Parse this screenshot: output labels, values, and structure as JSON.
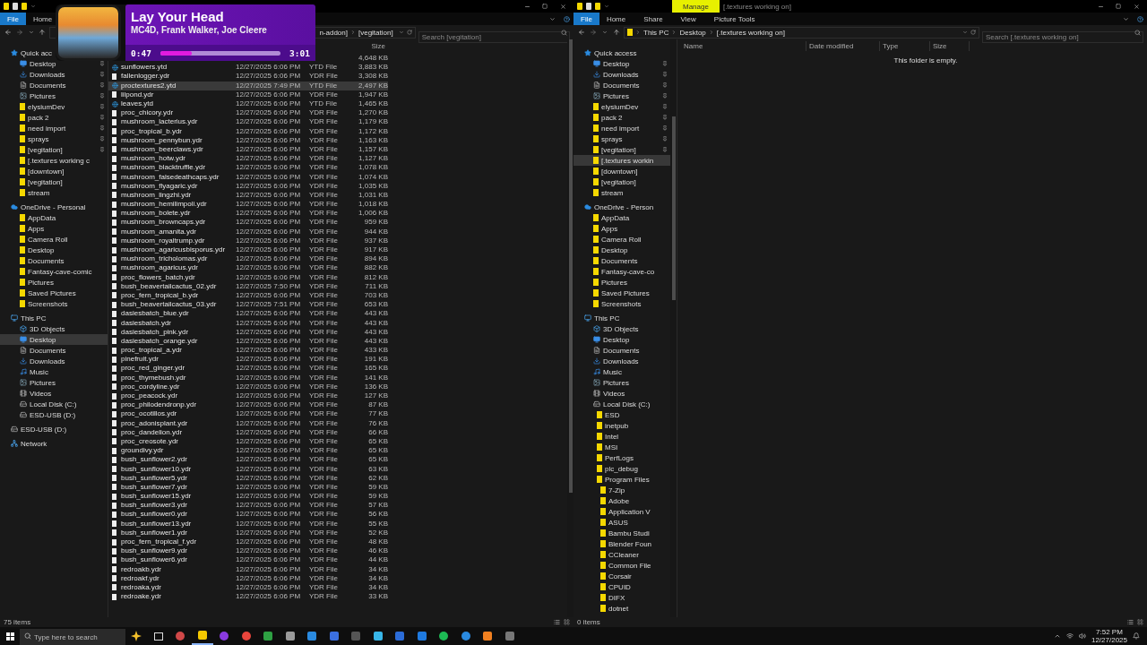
{
  "left_window": {
    "ribbon_tabs": [
      {
        "label": "File",
        "kind": "file"
      },
      {
        "label": "Home",
        "kind": "tab"
      }
    ],
    "address": [
      "n-addon]",
      "[vegitation]"
    ],
    "search": {
      "placeholder": "Search [vegitation]"
    },
    "nav": [
      {
        "label": "Quick acc",
        "kind": "star",
        "selected": false,
        "children": [
          {
            "label": "Desktop",
            "kind": "desktop",
            "pinned": true,
            "selected": false
          },
          {
            "label": "Downloads",
            "kind": "download",
            "pinned": true,
            "selected": false
          },
          {
            "label": "Documents",
            "kind": "document",
            "pinned": true,
            "selected": false
          },
          {
            "label": "Pictures",
            "kind": "picture",
            "pinned": true,
            "selected": false
          },
          {
            "label": "elysiumDev",
            "kind": "folder",
            "pinned": true,
            "selected": false
          },
          {
            "label": "pack 2",
            "kind": "folder",
            "pinned": true,
            "selected": false
          },
          {
            "label": "need import",
            "kind": "folder",
            "pinned": true,
            "selected": false
          },
          {
            "label": "sprays",
            "kind": "folder",
            "pinned": true,
            "selected": false
          },
          {
            "label": "[vegitation]",
            "kind": "folder",
            "pinned": true,
            "selected": false
          },
          {
            "label": "[.textures working c",
            "kind": "folder",
            "pinned": false,
            "selected": false
          },
          {
            "label": "[downtown]",
            "kind": "folder",
            "pinned": false,
            "selected": false
          },
          {
            "label": "[vegitation]",
            "kind": "folder",
            "pinned": false,
            "selected": false
          },
          {
            "label": "stream",
            "kind": "folder",
            "pinned": false,
            "selected": false
          }
        ]
      },
      {
        "label": "OneDrive - Personal",
        "kind": "cloud",
        "selected": false,
        "children": [
          {
            "label": "AppData",
            "kind": "folder",
            "selected": false
          },
          {
            "label": "Apps",
            "kind": "folder",
            "selected": false
          },
          {
            "label": "Camera Roll",
            "kind": "folder",
            "selected": false
          },
          {
            "label": "Desktop",
            "kind": "folder",
            "selected": false
          },
          {
            "label": "Documents",
            "kind": "folder",
            "selected": false
          },
          {
            "label": "Fantasy-cave-comic",
            "kind": "folder",
            "selected": false
          },
          {
            "label": "Pictures",
            "kind": "folder",
            "selected": false
          },
          {
            "label": "Saved Pictures",
            "kind": "folder",
            "selected": false
          },
          {
            "label": "Screenshots",
            "kind": "folder",
            "selected": false
          }
        ]
      },
      {
        "label": "This PC",
        "kind": "pc",
        "selected": false,
        "children": [
          {
            "label": "3D Objects",
            "kind": "objects",
            "selected": false
          },
          {
            "label": "Desktop",
            "kind": "desktop",
            "selected": true
          },
          {
            "label": "Documents",
            "kind": "document",
            "selected": false
          },
          {
            "label": "Downloads",
            "kind": "download",
            "selected": false
          },
          {
            "label": "Music",
            "kind": "music",
            "selected": false
          },
          {
            "label": "Pictures",
            "kind": "picture",
            "selected": false
          },
          {
            "label": "Videos",
            "kind": "video",
            "selected": false
          },
          {
            "label": "Local Disk (C:)",
            "kind": "disk",
            "selected": false
          },
          {
            "label": "ESD-USB (D:)",
            "kind": "disk",
            "selected": false
          }
        ]
      },
      {
        "label": "ESD-USB (D:)",
        "kind": "disk",
        "selected": false
      },
      {
        "label": "Network",
        "kind": "network",
        "selected": false
      }
    ],
    "header": {
      "size": "Size"
    },
    "files": [
      {
        "size": "4,648 KB",
        "selected": false
      },
      {
        "name": "sunflowers.ytd",
        "date": "12/27/2025 6:06 PM",
        "type": "YTD File",
        "size": "3,883 KB",
        "kind": "texture",
        "selected": false
      },
      {
        "name": "fallenlogger.ydr",
        "date": "12/27/2025 6:06 PM",
        "type": "YDR File",
        "size": "3,308 KB",
        "kind": "model",
        "selected": false
      },
      {
        "name": "proctextures2.ytd",
        "date": "12/27/2025 7:49 PM",
        "type": "YTD File",
        "size": "2,497 KB",
        "kind": "texture",
        "selected": true
      },
      {
        "name": "lilpond.ydr",
        "date": "12/27/2025 6:06 PM",
        "type": "YDR File",
        "size": "1,947 KB",
        "kind": "model",
        "selected": false
      },
      {
        "name": "leaves.ytd",
        "date": "12/27/2025 6:06 PM",
        "type": "YTD File",
        "size": "1,465 KB",
        "kind": "texture",
        "selected": false
      },
      {
        "name": "proc_chicory.ydr",
        "date": "12/27/2025 6:06 PM",
        "type": "YDR File",
        "size": "1,270 KB",
        "kind": "model",
        "selected": false
      },
      {
        "name": "mushroom_lacterius.ydr",
        "date": "12/27/2025 6:06 PM",
        "type": "YDR File",
        "size": "1,179 KB",
        "kind": "model",
        "selected": false
      },
      {
        "name": "proc_tropical_b.ydr",
        "date": "12/27/2025 6:06 PM",
        "type": "YDR File",
        "size": "1,172 KB",
        "kind": "model",
        "selected": false
      },
      {
        "name": "mushroom_pennybun.ydr",
        "date": "12/27/2025 6:06 PM",
        "type": "YDR File",
        "size": "1,163 KB",
        "kind": "model",
        "selected": false
      },
      {
        "name": "mushroom_beerclaws.ydr",
        "date": "12/27/2025 6:06 PM",
        "type": "YDR File",
        "size": "1,157 KB",
        "kind": "model",
        "selected": false
      },
      {
        "name": "mushroom_hotw.ydr",
        "date": "12/27/2025 6:06 PM",
        "type": "YDR File",
        "size": "1,127 KB",
        "kind": "model",
        "selected": false
      },
      {
        "name": "mushroom_blacktruffle.ydr",
        "date": "12/27/2025 6:06 PM",
        "type": "YDR File",
        "size": "1,078 KB",
        "kind": "model",
        "selected": false
      },
      {
        "name": "mushroom_falsedeathcaps.ydr",
        "date": "12/27/2025 6:06 PM",
        "type": "YDR File",
        "size": "1,074 KB",
        "kind": "model",
        "selected": false
      },
      {
        "name": "mushroom_flyagaric.ydr",
        "date": "12/27/2025 6:06 PM",
        "type": "YDR File",
        "size": "1,035 KB",
        "kind": "model",
        "selected": false
      },
      {
        "name": "mushroom_lingzhi.ydr",
        "date": "12/27/2025 6:06 PM",
        "type": "YDR File",
        "size": "1,031 KB",
        "kind": "model",
        "selected": false
      },
      {
        "name": "mushroom_hemilimpoli.ydr",
        "date": "12/27/2025 6:06 PM",
        "type": "YDR File",
        "size": "1,018 KB",
        "kind": "model",
        "selected": false
      },
      {
        "name": "mushroom_bolete.ydr",
        "date": "12/27/2025 6:06 PM",
        "type": "YDR File",
        "size": "1,006 KB",
        "kind": "model",
        "selected": false
      },
      {
        "name": "mushroom_browncaps.ydr",
        "date": "12/27/2025 6:06 PM",
        "type": "YDR File",
        "size": "959 KB",
        "kind": "model",
        "selected": false
      },
      {
        "name": "mushroom_amanita.ydr",
        "date": "12/27/2025 6:06 PM",
        "type": "YDR File",
        "size": "944 KB",
        "kind": "model",
        "selected": false
      },
      {
        "name": "mushroom_royaltrump.ydr",
        "date": "12/27/2025 6:06 PM",
        "type": "YDR File",
        "size": "937 KB",
        "kind": "model",
        "selected": false
      },
      {
        "name": "mushroom_agaricusbisporus.ydr",
        "date": "12/27/2025 6:06 PM",
        "type": "YDR File",
        "size": "917 KB",
        "kind": "model",
        "selected": false
      },
      {
        "name": "mushroom_tricholomas.ydr",
        "date": "12/27/2025 6:06 PM",
        "type": "YDR File",
        "size": "894 KB",
        "kind": "model",
        "selected": false
      },
      {
        "name": "mushroom_agaricus.ydr",
        "date": "12/27/2025 6:06 PM",
        "type": "YDR File",
        "size": "882 KB",
        "kind": "model",
        "selected": false
      },
      {
        "name": "proc_flowers_batch.ydr",
        "date": "12/27/2025 6:06 PM",
        "type": "YDR File",
        "size": "812 KB",
        "kind": "model",
        "selected": false
      },
      {
        "name": "bush_beavertailcactus_02.ydr",
        "date": "12/27/2025 7:50 PM",
        "type": "YDR File",
        "size": "711 KB",
        "kind": "model",
        "selected": false
      },
      {
        "name": "proc_fern_tropical_b.ydr",
        "date": "12/27/2025 6:06 PM",
        "type": "YDR File",
        "size": "703 KB",
        "kind": "model",
        "selected": false
      },
      {
        "name": "bush_beavertailcactus_03.ydr",
        "date": "12/27/2025 7:51 PM",
        "type": "YDR File",
        "size": "653 KB",
        "kind": "model",
        "selected": false
      },
      {
        "name": "dasiesbatch_blue.ydr",
        "date": "12/27/2025 6:06 PM",
        "type": "YDR File",
        "size": "443 KB",
        "kind": "model",
        "selected": false
      },
      {
        "name": "dasiesbatch.ydr",
        "date": "12/27/2025 6:06 PM",
        "type": "YDR File",
        "size": "443 KB",
        "kind": "model",
        "selected": false
      },
      {
        "name": "dasiesbatch_pink.ydr",
        "date": "12/27/2025 6:06 PM",
        "type": "YDR File",
        "size": "443 KB",
        "kind": "model",
        "selected": false
      },
      {
        "name": "dasiesbatch_orange.ydr",
        "date": "12/27/2025 6:06 PM",
        "type": "YDR File",
        "size": "443 KB",
        "kind": "model",
        "selected": false
      },
      {
        "name": "proc_tropical_a.ydr",
        "date": "12/27/2025 6:06 PM",
        "type": "YDR File",
        "size": "433 KB",
        "kind": "model",
        "selected": false
      },
      {
        "name": "pinefruit.ydr",
        "date": "12/27/2025 6:06 PM",
        "type": "YDR File",
        "size": "191 KB",
        "kind": "model",
        "selected": false
      },
      {
        "name": "proc_red_ginger.ydr",
        "date": "12/27/2025 6:06 PM",
        "type": "YDR File",
        "size": "165 KB",
        "kind": "model",
        "selected": false
      },
      {
        "name": "proc_thymebush.ydr",
        "date": "12/27/2025 6:06 PM",
        "type": "YDR File",
        "size": "141 KB",
        "kind": "model",
        "selected": false
      },
      {
        "name": "proc_cordyline.ydr",
        "date": "12/27/2025 6:06 PM",
        "type": "YDR File",
        "size": "136 KB",
        "kind": "model",
        "selected": false
      },
      {
        "name": "proc_peacock.ydr",
        "date": "12/27/2025 6:06 PM",
        "type": "YDR File",
        "size": "127 KB",
        "kind": "model",
        "selected": false
      },
      {
        "name": "proc_philodendronp.ydr",
        "date": "12/27/2025 6:06 PM",
        "type": "YDR File",
        "size": "87 KB",
        "kind": "model",
        "selected": false
      },
      {
        "name": "proc_ocotillos.ydr",
        "date": "12/27/2025 6:06 PM",
        "type": "YDR File",
        "size": "77 KB",
        "kind": "model",
        "selected": false
      },
      {
        "name": "proc_adonisplant.ydr",
        "date": "12/27/2025 6:06 PM",
        "type": "YDR File",
        "size": "76 KB",
        "kind": "model",
        "selected": false
      },
      {
        "name": "proc_dandelion.ydr",
        "date": "12/27/2025 6:06 PM",
        "type": "YDR File",
        "size": "66 KB",
        "kind": "model",
        "selected": false
      },
      {
        "name": "proc_creosote.ydr",
        "date": "12/27/2025 6:06 PM",
        "type": "YDR File",
        "size": "65 KB",
        "kind": "model",
        "selected": false
      },
      {
        "name": "groundivy.ydr",
        "date": "12/27/2025 6:06 PM",
        "type": "YDR File",
        "size": "65 KB",
        "kind": "model",
        "selected": false
      },
      {
        "name": "bush_sunflower2.ydr",
        "date": "12/27/2025 6:06 PM",
        "type": "YDR File",
        "size": "65 KB",
        "kind": "model",
        "selected": false
      },
      {
        "name": "bush_sunflower10.ydr",
        "date": "12/27/2025 6:06 PM",
        "type": "YDR File",
        "size": "63 KB",
        "kind": "model",
        "selected": false
      },
      {
        "name": "bush_sunflower5.ydr",
        "date": "12/27/2025 6:06 PM",
        "type": "YDR File",
        "size": "62 KB",
        "kind": "model",
        "selected": false
      },
      {
        "name": "bush_sunflower7.ydr",
        "date": "12/27/2025 6:06 PM",
        "type": "YDR File",
        "size": "59 KB",
        "kind": "model",
        "selected": false
      },
      {
        "name": "bush_sunflower15.ydr",
        "date": "12/27/2025 6:06 PM",
        "type": "YDR File",
        "size": "59 KB",
        "kind": "model",
        "selected": false
      },
      {
        "name": "bush_sunflower3.ydr",
        "date": "12/27/2025 6:06 PM",
        "type": "YDR File",
        "size": "57 KB",
        "kind": "model",
        "selected": false
      },
      {
        "name": "bush_sunflower0.ydr",
        "date": "12/27/2025 6:06 PM",
        "type": "YDR File",
        "size": "56 KB",
        "kind": "model",
        "selected": false
      },
      {
        "name": "bush_sunflower13.ydr",
        "date": "12/27/2025 6:06 PM",
        "type": "YDR File",
        "size": "55 KB",
        "kind": "model",
        "selected": false
      },
      {
        "name": "bush_sunflower1.ydr",
        "date": "12/27/2025 6:06 PM",
        "type": "YDR File",
        "size": "52 KB",
        "kind": "model",
        "selected": false
      },
      {
        "name": "proc_fern_tropical_f.ydr",
        "date": "12/27/2025 6:06 PM",
        "type": "YDR File",
        "size": "48 KB",
        "kind": "model",
        "selected": false
      },
      {
        "name": "bush_sunflower9.ydr",
        "date": "12/27/2025 6:06 PM",
        "type": "YDR File",
        "size": "46 KB",
        "kind": "model",
        "selected": false
      },
      {
        "name": "bush_sunflower6.ydr",
        "date": "12/27/2025 6:06 PM",
        "type": "YDR File",
        "size": "44 KB",
        "kind": "model",
        "selected": false
      },
      {
        "name": "redroakb.ydr",
        "date": "12/27/2025 6:06 PM",
        "type": "YDR File",
        "size": "34 KB",
        "kind": "model",
        "selected": false
      },
      {
        "name": "redroakf.ydr",
        "date": "12/27/2025 6:06 PM",
        "type": "YDR File",
        "size": "34 KB",
        "kind": "model",
        "selected": false
      },
      {
        "name": "redroaka.ydr",
        "date": "12/27/2025 6:06 PM",
        "type": "YDR File",
        "size": "34 KB",
        "kind": "model",
        "selected": false
      },
      {
        "name": "redroake.ydr",
        "date": "12/27/2025 6:06 PM",
        "type": "YDR File",
        "size": "33 KB",
        "kind": "model",
        "selected": false
      }
    ],
    "status": "75 items"
  },
  "right_window": {
    "context_tab": "Manage",
    "title": "[.textures working on]",
    "ribbon_tabs": [
      {
        "label": "File",
        "kind": "file"
      },
      {
        "label": "Home",
        "kind": "tab"
      },
      {
        "label": "Share",
        "kind": "tab"
      },
      {
        "label": "View",
        "kind": "tab"
      },
      {
        "label": "Picture Tools",
        "kind": "tab"
      }
    ],
    "address": [
      "This PC",
      "Desktop",
      "[.textures working on]"
    ],
    "search": {
      "placeholder": "Search [.textures working on]"
    },
    "nav": [
      {
        "label": "Quick access",
        "kind": "star",
        "selected": false,
        "children": [
          {
            "label": "Desktop",
            "kind": "desktop",
            "pinned": true,
            "selected": false
          },
          {
            "label": "Downloads",
            "kind": "download",
            "pinned": true,
            "selected": false
          },
          {
            "label": "Documents",
            "kind": "document",
            "pinned": true,
            "selected": false
          },
          {
            "label": "Pictures",
            "kind": "picture",
            "pinned": true,
            "selected": false
          },
          {
            "label": "elysiumDev",
            "kind": "folder",
            "pinned": true,
            "selected": false
          },
          {
            "label": "pack 2",
            "kind": "folder",
            "pinned": true,
            "selected": false
          },
          {
            "label": "need import",
            "kind": "folder",
            "pinned": true,
            "selected": false
          },
          {
            "label": "sprays",
            "kind": "folder",
            "pinned": true,
            "selected": false
          },
          {
            "label": "[vegitation]",
            "kind": "folder",
            "pinned": true,
            "selected": false
          },
          {
            "label": "[.textures workin",
            "kind": "folder",
            "pinned": false,
            "selected": true
          },
          {
            "label": "[downtown]",
            "kind": "folder",
            "pinned": false,
            "selected": false
          },
          {
            "label": "[vegitation]",
            "kind": "folder",
            "pinned": false,
            "selected": false
          },
          {
            "label": "stream",
            "kind": "folder",
            "pinned": false,
            "selected": false
          }
        ]
      },
      {
        "label": "OneDrive - Person",
        "kind": "cloud",
        "selected": false,
        "children": [
          {
            "label": "AppData",
            "kind": "folder",
            "selected": false
          },
          {
            "label": "Apps",
            "kind": "folder",
            "selected": false
          },
          {
            "label": "Camera Roll",
            "kind": "folder",
            "selected": false
          },
          {
            "label": "Desktop",
            "kind": "folder",
            "selected": false
          },
          {
            "label": "Documents",
            "kind": "folder",
            "selected": false
          },
          {
            "label": "Fantasy-cave-co",
            "kind": "folder",
            "selected": false
          },
          {
            "label": "Pictures",
            "kind": "folder",
            "selected": false
          },
          {
            "label": "Saved Pictures",
            "kind": "folder",
            "selected": false
          },
          {
            "label": "Screenshots",
            "kind": "folder",
            "selected": false
          }
        ]
      },
      {
        "label": "This PC",
        "kind": "pc",
        "selected": false,
        "children": [
          {
            "label": "3D Objects",
            "kind": "objects",
            "selected": false
          },
          {
            "label": "Desktop",
            "kind": "desktop",
            "selected": false
          },
          {
            "label": "Documents",
            "kind": "document",
            "selected": false
          },
          {
            "label": "Downloads",
            "kind": "download",
            "selected": false
          },
          {
            "label": "Music",
            "kind": "music",
            "selected": false
          },
          {
            "label": "Pictures",
            "kind": "picture",
            "selected": false
          },
          {
            "label": "Videos",
            "kind": "video",
            "selected": false
          },
          {
            "label": "Local Disk (C:)",
            "kind": "disk",
            "selected": false,
            "children": [
              {
                "label": "ESD",
                "kind": "folder",
                "selected": false
              },
              {
                "label": "inetpub",
                "kind": "folder",
                "selected": false
              },
              {
                "label": "Intel",
                "kind": "folder",
                "selected": false
              },
              {
                "label": "MSI",
                "kind": "folder",
                "selected": false
              },
              {
                "label": "PerfLogs",
                "kind": "folder",
                "selected": false
              },
              {
                "label": "plc_debug",
                "kind": "folder",
                "selected": false
              },
              {
                "label": "Program Files",
                "kind": "folder",
                "selected": false,
                "children": [
                  {
                    "label": "7-Zip",
                    "kind": "folder",
                    "selected": false
                  },
                  {
                    "label": "Adobe",
                    "kind": "folder",
                    "selected": false
                  },
                  {
                    "label": "Application V",
                    "kind": "folder",
                    "selected": false
                  },
                  {
                    "label": "ASUS",
                    "kind": "folder",
                    "selected": false
                  },
                  {
                    "label": "Bambu Studi",
                    "kind": "folder",
                    "selected": false
                  },
                  {
                    "label": "Blender Foun",
                    "kind": "folder",
                    "selected": false
                  },
                  {
                    "label": "CCleaner",
                    "kind": "folder",
                    "selected": false
                  },
                  {
                    "label": "Common File",
                    "kind": "folder",
                    "selected": false
                  },
                  {
                    "label": "Corsair",
                    "kind": "folder",
                    "selected": false
                  },
                  {
                    "label": "CPUID",
                    "kind": "folder",
                    "selected": false
                  },
                  {
                    "label": "DIFX",
                    "kind": "folder",
                    "selected": false
                  },
                  {
                    "label": "dotnet",
                    "kind": "folder",
                    "selected": false
                  }
                ]
              }
            ]
          }
        ]
      }
    ],
    "header": {
      "name": "Name",
      "date": "Date modified",
      "type": "Type",
      "size": "Size"
    },
    "empty_message": "This folder is empty.",
    "status": "0 items"
  },
  "now_playing": {
    "title": "Lay Your Head",
    "artists": "MC4D, Frank Walker, Joe Cleere",
    "elapsed": "0:47",
    "duration": "3:01",
    "level": 0.26
  },
  "taskbar": {
    "search": {
      "placeholder": "Type here to search"
    },
    "time": "7:52 PM",
    "date": "12/27/2025"
  }
}
